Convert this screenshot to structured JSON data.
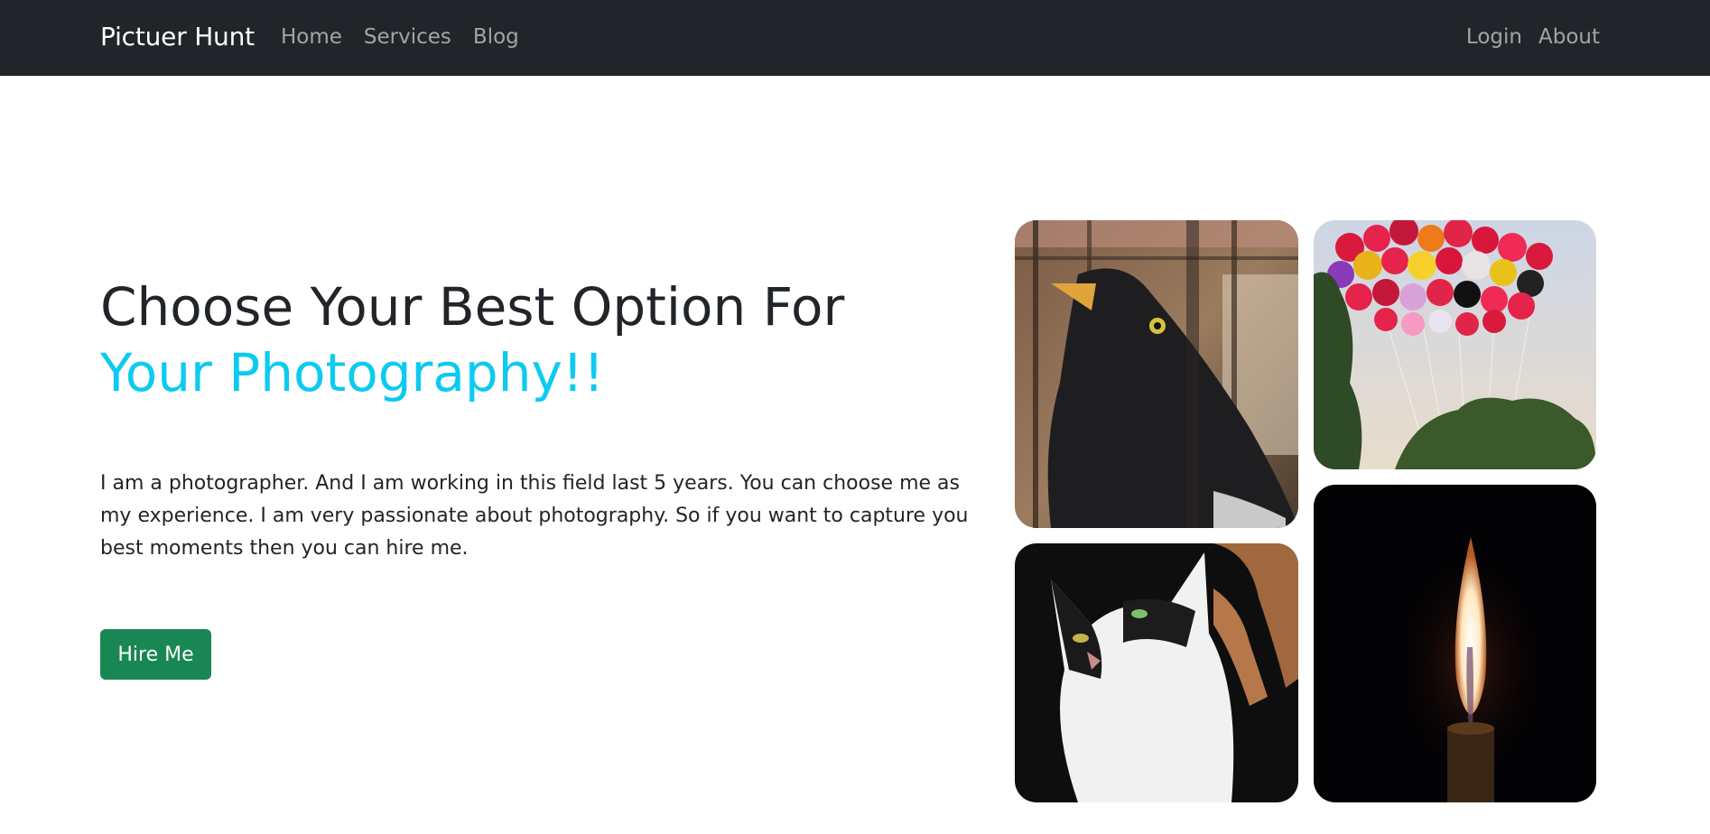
{
  "navbar": {
    "brand": "Pictuer Hunt",
    "left_links": [
      "Home",
      "Services",
      "Blog"
    ],
    "right_links": [
      "Login",
      "About"
    ]
  },
  "hero": {
    "title_line1": "Choose Your Best Option For",
    "title_line2": "Your Photography!!",
    "description": "I am a photographer. And I am working in this field last 5 years. You can choose me as my experience. I am very passionate about photography. So if you want to capture you best moments then you can hire me.",
    "button_label": "Hire Me"
  },
  "gallery": {
    "photos": [
      "bird-photo",
      "balloons-photo",
      "cat-photo",
      "candle-photo"
    ]
  },
  "colors": {
    "navbar_bg": "#212529",
    "accent": "#0dcaf0",
    "button": "#198754"
  }
}
